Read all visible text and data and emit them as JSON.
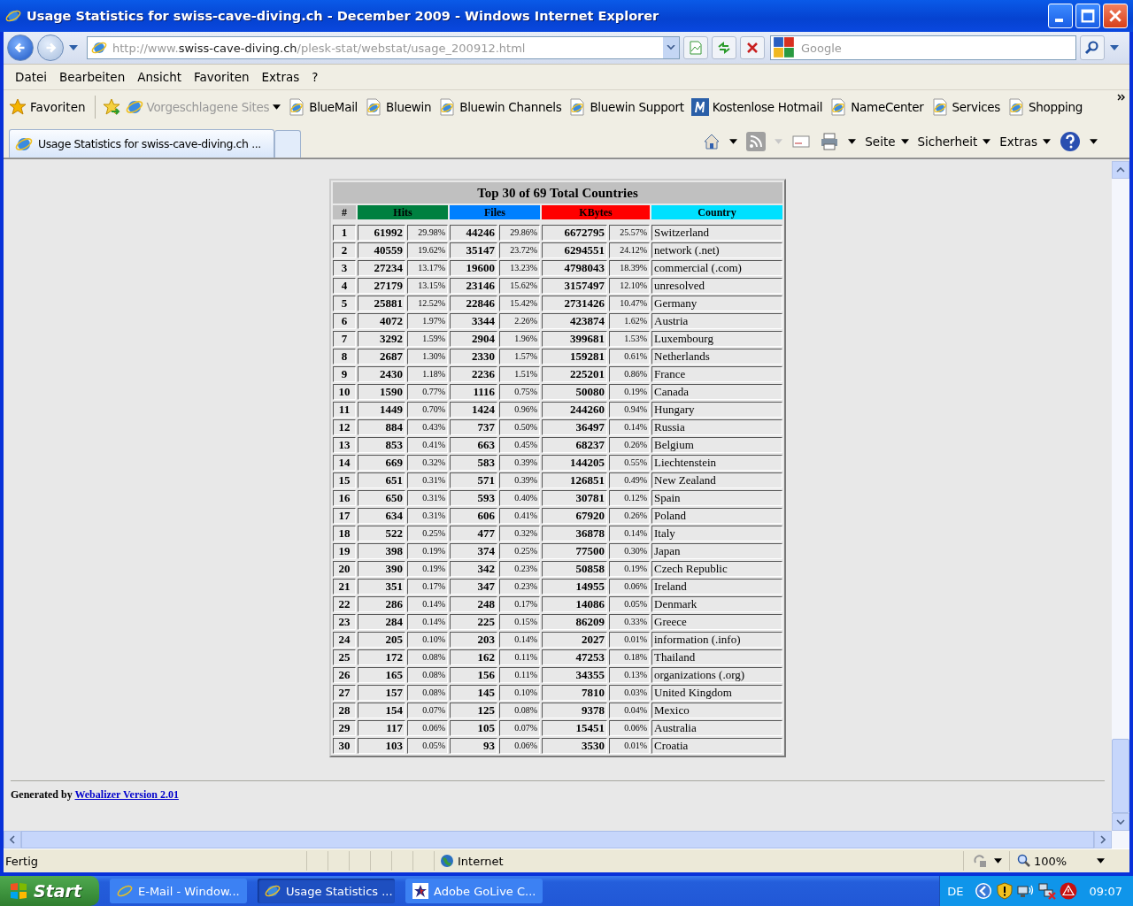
{
  "window": {
    "title": "Usage Statistics for swiss-cave-diving.ch - December 2009 - Windows Internet Explorer"
  },
  "address_bar": {
    "url_parts": [
      {
        "text": "http://www.",
        "kind": "dim"
      },
      {
        "text": "swiss-cave-diving.ch",
        "kind": "host"
      },
      {
        "text": "/plesk-stat/webstat/usage_200912.html",
        "kind": "dim"
      }
    ]
  },
  "search": {
    "placeholder": "Google"
  },
  "menu": [
    "Datei",
    "Bearbeiten",
    "Ansicht",
    "Favoriten",
    "Extras",
    "?"
  ],
  "favorites_bar": {
    "label": "Favoriten",
    "links": [
      {
        "label": "Vorgeschlagene Sites",
        "kind": "suggested"
      },
      {
        "label": "BlueMail",
        "kind": "page"
      },
      {
        "label": "Bluewin",
        "kind": "page"
      },
      {
        "label": "Bluewin Channels",
        "kind": "page"
      },
      {
        "label": "Bluewin Support",
        "kind": "page"
      },
      {
        "label": "Kostenlose Hotmail",
        "kind": "m"
      },
      {
        "label": "NameCenter",
        "kind": "page"
      },
      {
        "label": "Services",
        "kind": "page"
      },
      {
        "label": "Shopping",
        "kind": "page"
      }
    ]
  },
  "tabs": [
    {
      "label": "Usage Statistics for swiss-cave-diving.ch ...",
      "selected": true
    }
  ],
  "command_bar": [
    "Seite",
    "Sicherheit",
    "Extras"
  ],
  "table": {
    "title": "Top 30 of 69 Total Countries",
    "columns": [
      {
        "label": "#",
        "color": "#c0c0c0"
      },
      {
        "label": "Hits",
        "color": "#008040"
      },
      {
        "label": "Files",
        "color": "#0080ff"
      },
      {
        "label": "KBytes",
        "color": "#ff0000"
      },
      {
        "label": "Country",
        "color": "#00e0ff"
      }
    ],
    "rows": [
      {
        "rank": "1",
        "hits": "61992",
        "hits_pct": "29.98%",
        "files": "44246",
        "files_pct": "29.86%",
        "kbytes": "6672795",
        "kbytes_pct": "25.57%",
        "country": "Switzerland"
      },
      {
        "rank": "2",
        "hits": "40559",
        "hits_pct": "19.62%",
        "files": "35147",
        "files_pct": "23.72%",
        "kbytes": "6294551",
        "kbytes_pct": "24.12%",
        "country": "network (.net)"
      },
      {
        "rank": "3",
        "hits": "27234",
        "hits_pct": "13.17%",
        "files": "19600",
        "files_pct": "13.23%",
        "kbytes": "4798043",
        "kbytes_pct": "18.39%",
        "country": "commercial (.com)"
      },
      {
        "rank": "4",
        "hits": "27179",
        "hits_pct": "13.15%",
        "files": "23146",
        "files_pct": "15.62%",
        "kbytes": "3157497",
        "kbytes_pct": "12.10%",
        "country": "unresolved"
      },
      {
        "rank": "5",
        "hits": "25881",
        "hits_pct": "12.52%",
        "files": "22846",
        "files_pct": "15.42%",
        "kbytes": "2731426",
        "kbytes_pct": "10.47%",
        "country": "Germany"
      },
      {
        "rank": "6",
        "hits": "4072",
        "hits_pct": "1.97%",
        "files": "3344",
        "files_pct": "2.26%",
        "kbytes": "423874",
        "kbytes_pct": "1.62%",
        "country": "Austria"
      },
      {
        "rank": "7",
        "hits": "3292",
        "hits_pct": "1.59%",
        "files": "2904",
        "files_pct": "1.96%",
        "kbytes": "399681",
        "kbytes_pct": "1.53%",
        "country": "Luxembourg"
      },
      {
        "rank": "8",
        "hits": "2687",
        "hits_pct": "1.30%",
        "files": "2330",
        "files_pct": "1.57%",
        "kbytes": "159281",
        "kbytes_pct": "0.61%",
        "country": "Netherlands"
      },
      {
        "rank": "9",
        "hits": "2430",
        "hits_pct": "1.18%",
        "files": "2236",
        "files_pct": "1.51%",
        "kbytes": "225201",
        "kbytes_pct": "0.86%",
        "country": "France"
      },
      {
        "rank": "10",
        "hits": "1590",
        "hits_pct": "0.77%",
        "files": "1116",
        "files_pct": "0.75%",
        "kbytes": "50080",
        "kbytes_pct": "0.19%",
        "country": "Canada"
      },
      {
        "rank": "11",
        "hits": "1449",
        "hits_pct": "0.70%",
        "files": "1424",
        "files_pct": "0.96%",
        "kbytes": "244260",
        "kbytes_pct": "0.94%",
        "country": "Hungary"
      },
      {
        "rank": "12",
        "hits": "884",
        "hits_pct": "0.43%",
        "files": "737",
        "files_pct": "0.50%",
        "kbytes": "36497",
        "kbytes_pct": "0.14%",
        "country": "Russia"
      },
      {
        "rank": "13",
        "hits": "853",
        "hits_pct": "0.41%",
        "files": "663",
        "files_pct": "0.45%",
        "kbytes": "68237",
        "kbytes_pct": "0.26%",
        "country": "Belgium"
      },
      {
        "rank": "14",
        "hits": "669",
        "hits_pct": "0.32%",
        "files": "583",
        "files_pct": "0.39%",
        "kbytes": "144205",
        "kbytes_pct": "0.55%",
        "country": "Liechtenstein"
      },
      {
        "rank": "15",
        "hits": "651",
        "hits_pct": "0.31%",
        "files": "571",
        "files_pct": "0.39%",
        "kbytes": "126851",
        "kbytes_pct": "0.49%",
        "country": "New Zealand"
      },
      {
        "rank": "16",
        "hits": "650",
        "hits_pct": "0.31%",
        "files": "593",
        "files_pct": "0.40%",
        "kbytes": "30781",
        "kbytes_pct": "0.12%",
        "country": "Spain"
      },
      {
        "rank": "17",
        "hits": "634",
        "hits_pct": "0.31%",
        "files": "606",
        "files_pct": "0.41%",
        "kbytes": "67920",
        "kbytes_pct": "0.26%",
        "country": "Poland"
      },
      {
        "rank": "18",
        "hits": "522",
        "hits_pct": "0.25%",
        "files": "477",
        "files_pct": "0.32%",
        "kbytes": "36878",
        "kbytes_pct": "0.14%",
        "country": "Italy"
      },
      {
        "rank": "19",
        "hits": "398",
        "hits_pct": "0.19%",
        "files": "374",
        "files_pct": "0.25%",
        "kbytes": "77500",
        "kbytes_pct": "0.30%",
        "country": "Japan"
      },
      {
        "rank": "20",
        "hits": "390",
        "hits_pct": "0.19%",
        "files": "342",
        "files_pct": "0.23%",
        "kbytes": "50858",
        "kbytes_pct": "0.19%",
        "country": "Czech Republic"
      },
      {
        "rank": "21",
        "hits": "351",
        "hits_pct": "0.17%",
        "files": "347",
        "files_pct": "0.23%",
        "kbytes": "14955",
        "kbytes_pct": "0.06%",
        "country": "Ireland"
      },
      {
        "rank": "22",
        "hits": "286",
        "hits_pct": "0.14%",
        "files": "248",
        "files_pct": "0.17%",
        "kbytes": "14086",
        "kbytes_pct": "0.05%",
        "country": "Denmark"
      },
      {
        "rank": "23",
        "hits": "284",
        "hits_pct": "0.14%",
        "files": "225",
        "files_pct": "0.15%",
        "kbytes": "86209",
        "kbytes_pct": "0.33%",
        "country": "Greece"
      },
      {
        "rank": "24",
        "hits": "205",
        "hits_pct": "0.10%",
        "files": "203",
        "files_pct": "0.14%",
        "kbytes": "2027",
        "kbytes_pct": "0.01%",
        "country": "information (.info)"
      },
      {
        "rank": "25",
        "hits": "172",
        "hits_pct": "0.08%",
        "files": "162",
        "files_pct": "0.11%",
        "kbytes": "47253",
        "kbytes_pct": "0.18%",
        "country": "Thailand"
      },
      {
        "rank": "26",
        "hits": "165",
        "hits_pct": "0.08%",
        "files": "156",
        "files_pct": "0.11%",
        "kbytes": "34355",
        "kbytes_pct": "0.13%",
        "country": "organizations (.org)"
      },
      {
        "rank": "27",
        "hits": "157",
        "hits_pct": "0.08%",
        "files": "145",
        "files_pct": "0.10%",
        "kbytes": "7810",
        "kbytes_pct": "0.03%",
        "country": "United Kingdom"
      },
      {
        "rank": "28",
        "hits": "154",
        "hits_pct": "0.07%",
        "files": "125",
        "files_pct": "0.08%",
        "kbytes": "9378",
        "kbytes_pct": "0.04%",
        "country": "Mexico"
      },
      {
        "rank": "29",
        "hits": "117",
        "hits_pct": "0.06%",
        "files": "105",
        "files_pct": "0.07%",
        "kbytes": "15451",
        "kbytes_pct": "0.06%",
        "country": "Australia"
      },
      {
        "rank": "30",
        "hits": "103",
        "hits_pct": "0.05%",
        "files": "93",
        "files_pct": "0.06%",
        "kbytes": "3530",
        "kbytes_pct": "0.01%",
        "country": "Croatia"
      }
    ]
  },
  "footer": {
    "text": "Generated by",
    "link": "Webalizer Version 2.01"
  },
  "status_bar": {
    "text": "Fertig",
    "zone": "Internet",
    "zoom": "100%"
  },
  "taskbar": {
    "start": "Start",
    "tasks": [
      {
        "label": "E-Mail - Window...",
        "kind": "ie",
        "selected": false
      },
      {
        "label": "Usage Statistics ...",
        "kind": "ie",
        "selected": true
      },
      {
        "label": "Adobe GoLive C...",
        "kind": "golive",
        "selected": false
      }
    ],
    "language": "DE",
    "clock": "09:07"
  }
}
